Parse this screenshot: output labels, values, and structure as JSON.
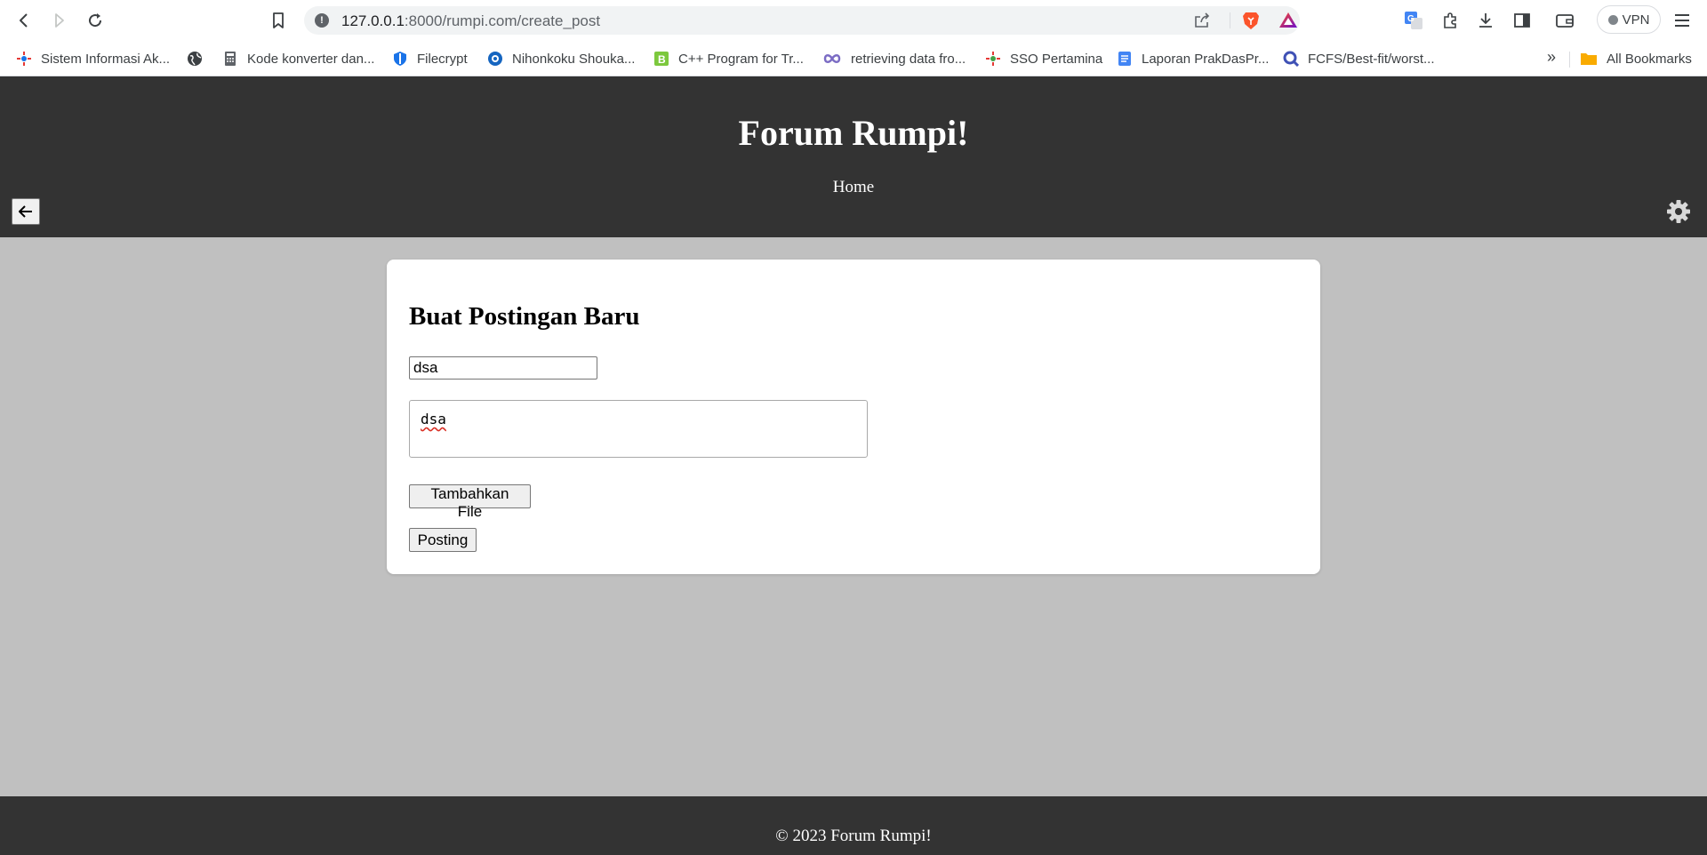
{
  "browser": {
    "url_host": "127.0.0.1",
    "url_rest": ":8000/rumpi.com/create_post",
    "vpn_label": "VPN",
    "bookmarks": [
      {
        "label": "Sistem Informasi Ak..."
      },
      {
        "label": ""
      },
      {
        "label": "Kode konverter dan..."
      },
      {
        "label": "Filecrypt"
      },
      {
        "label": "Nihonkoku Shouka..."
      },
      {
        "label": "C++ Program for Tr..."
      },
      {
        "label": "retrieving data fro..."
      },
      {
        "label": "SSO Pertamina"
      },
      {
        "label": "Laporan PrakDasPr..."
      },
      {
        "label": "FCFS/Best-fit/worst..."
      }
    ],
    "more_label": "»",
    "all_bookmarks_label": "All Bookmarks"
  },
  "header": {
    "title": "Forum Rumpi!",
    "nav_home": "Home"
  },
  "form": {
    "heading": "Buat Postingan Baru",
    "title_value": "dsa",
    "content_value": "dsa",
    "add_file_label": "Tambahkan File",
    "submit_label": "Posting"
  },
  "footer": {
    "text": "© 2023 Forum Rumpi!"
  },
  "colors": {
    "header_bg": "#333333",
    "page_bg": "#c0c0c0",
    "card_bg": "#ffffff"
  }
}
